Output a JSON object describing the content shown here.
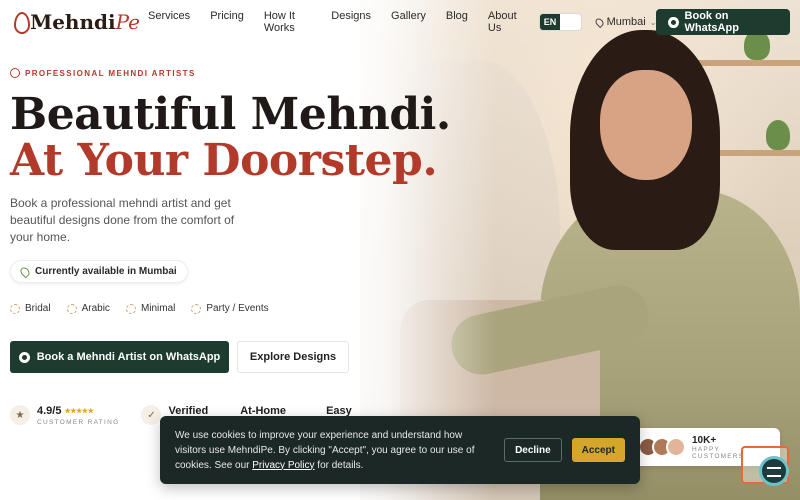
{
  "brand": {
    "logo_main": "Mehndi",
    "logo_accent": "Pe"
  },
  "nav": {
    "links": [
      "Services",
      "Pricing",
      "How It Works",
      "Designs",
      "Gallery",
      "Blog",
      "About Us"
    ],
    "lang_en": "EN",
    "lang_alt": "",
    "city": "Mumbai",
    "cta": "Book on WhatsApp"
  },
  "hero": {
    "eyebrow": "PROFESSIONAL MEHNDI ARTISTS",
    "headline_line1": "Beautiful Mehndi.",
    "headline_line2": "At Your Doorstep.",
    "subcopy": "Book a professional mehndi artist and get beautiful designs done from the comfort of your home.",
    "availability": "Currently available in Mumbai",
    "styles": [
      "Bridal",
      "Arabic",
      "Minimal",
      "Party / Events"
    ],
    "cta_primary": "Book a Mehndi Artist on WhatsApp",
    "cta_secondary": "Explore Designs"
  },
  "stats": {
    "rating_value": "4.9/5",
    "rating_label": "CUSTOMER RATING",
    "rating_stars": 5,
    "verified": "Verified",
    "at_home": "At-Home",
    "easy": "Easy"
  },
  "customers": {
    "count": "10K+",
    "label": "HAPPY CUSTOMERS"
  },
  "cookie": {
    "text_before_link": "We use cookies to improve your experience and understand how visitors use MehndiPe. By clicking \"Accept\", you agree to our use of cookies. See our ",
    "link": "Privacy Policy",
    "text_after_link": " for details.",
    "decline": "Decline",
    "accept": "Accept"
  },
  "colors": {
    "brand_green": "#1d3b2f",
    "accent_red": "#b23a2a",
    "gold": "#d4a62a"
  },
  "icons": [
    "whatsapp-icon",
    "map-pin-icon",
    "star-icon",
    "check-icon",
    "chat-icon"
  ]
}
